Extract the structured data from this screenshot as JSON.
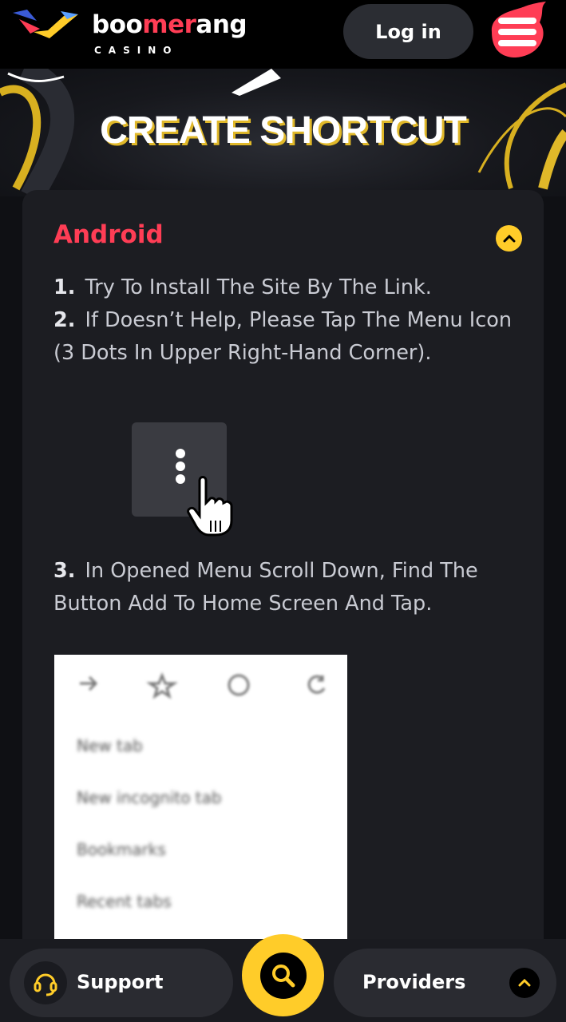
{
  "header": {
    "brand_part1": "boo",
    "brand_part2": "mer",
    "brand_part3": "ang",
    "brand_sub": "CASINO",
    "login_label": "Log in",
    "menu_icon": "burger-menu-icon"
  },
  "hero": {
    "title": "CREATE SHORTCUT"
  },
  "section": {
    "title": "Android",
    "toggle_icon": "chevron-up-icon",
    "steps": [
      {
        "num": "1.",
        "text": "Try To Install The Site By The Link."
      },
      {
        "num": "2.",
        "text": "If Doesn’t Help, Please Tap The Menu Icon (3 Dots In Upper Right-Hand Corner)."
      },
      {
        "num": "3.",
        "text": "In Opened Menu Scroll Down, Find The Button Add To Home Screen And Tap."
      }
    ],
    "menu_items": [
      "New tab",
      "New incognito tab",
      "Bookmarks",
      "Recent tabs"
    ]
  },
  "bottom_bar": {
    "support_label": "Support",
    "providers_label": "Providers",
    "search_icon": "search-icon"
  },
  "colors": {
    "accent_red": "#ff3d55",
    "accent_yellow": "#ffcc29",
    "card_bg": "#1c1d22"
  }
}
